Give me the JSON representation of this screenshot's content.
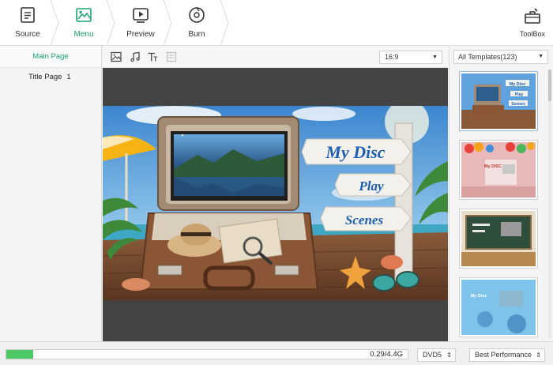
{
  "toolbar": {
    "steps": [
      {
        "label": "Source",
        "icon": "source-icon"
      },
      {
        "label": "Menu",
        "icon": "menu-image-icon"
      },
      {
        "label": "Preview",
        "icon": "preview-play-icon"
      },
      {
        "label": "Burn",
        "icon": "burn-disc-icon"
      }
    ],
    "active_step": "Menu",
    "toolbox_label": "ToolBox",
    "accent_color": "#1aa56d"
  },
  "left_panel": {
    "header": "Main Page",
    "items": [
      {
        "label": "Title Page",
        "number": "1"
      }
    ]
  },
  "editor": {
    "tools": [
      "image-icon",
      "music-icon",
      "text-icon",
      "chapter-icon"
    ],
    "aspect_ratio": "16:9"
  },
  "scene": {
    "sign_lines": [
      "My Disc",
      "Play",
      "Scenes"
    ]
  },
  "templates": {
    "filter": "All Templates(123)",
    "thumb_texts": [
      "My Disc",
      "Play",
      "Scenes",
      "My DISC",
      "My Disc"
    ]
  },
  "bottom": {
    "progress_fraction": 0.066,
    "size_text": "0.29/4.4G",
    "disc_type": "DVD5",
    "quality": "Best Performance",
    "progress_color": "#4ec766"
  }
}
